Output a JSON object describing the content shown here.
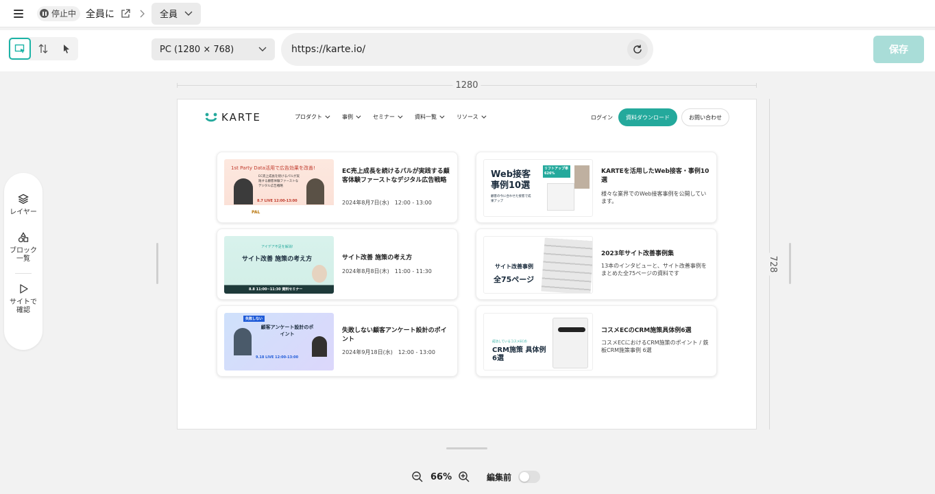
{
  "topbar": {
    "status": "停止中",
    "target_name": "全員に",
    "segment": "全員"
  },
  "toolbar": {
    "device": "PC (1280 × 768)",
    "url": "https://karte.io/",
    "save_label": "保存"
  },
  "left_panel": {
    "layers_label": "レイヤー",
    "blocks_label": "ブロック\n一覧",
    "preview_label": "サイトで\n確認"
  },
  "rulers": {
    "width_label": "1280",
    "height_label": "728"
  },
  "site": {
    "logo_text": "KARTE",
    "nav": [
      "プロダクト",
      "事例",
      "セミナー",
      "資料一覧",
      "リソース"
    ],
    "login": "ログイン",
    "download": "資料ダウンロード",
    "contact": "お問い合わせ",
    "cards": [
      {
        "title": "EC売上成長を続けるパルが実践する顧客体験ファーストなデジタル広告戦略",
        "sub": "2024年8月7日(水)　12:00 - 13:00",
        "thumb_text": "1st Party Data活用で広告効果を改善!",
        "thumb_sub": "EC売上成長を続けるパルが実践する顧客体験ファーストなデジタル広告戦略",
        "thumb_date": "8.7 LIVE 12:00-13:00",
        "thumb_brand": "PAL"
      },
      {
        "title": "KARTEを活用したWeb接客・事例10選",
        "sub": "様々な業界でのWeb接客事例を公開しています。",
        "thumb_text": "Web接客 事例10選",
        "thumb_sub": "顧客の今に合わせた接客で成果アップ",
        "thumb_badge": "リフトアップ率 626%"
      },
      {
        "title": "サイト改善 施策の考え方",
        "sub": "2024年8月8日(木)　11:00 - 11:30",
        "thumb_text": "サイト改善 施策の考え方",
        "thumb_sub": "アイデア不足を解消!",
        "thumb_date": "8.8 11:00~11:30 資料セミナー"
      },
      {
        "title": "2023年サイト改善事例集",
        "sub": "13本のインタビューと、サイト改善事例をまとめた全75ページの資料です",
        "thumb_text": "サイト改善事例",
        "thumb_sub": "全75ページ"
      },
      {
        "title": "失敗しない顧客アンケート設計のポイント",
        "sub": "2024年9月18日(水)　12:00 - 13:00",
        "thumb_text": "顧客アンケート設計のポイント",
        "thumb_sub": "失敗しない",
        "thumb_date": "9.18 LIVE 12:00-13:00"
      },
      {
        "title": "コスメECのCRM施策具体例6選",
        "sub": "コスメECにおけるCRM施策のポイント / 鉄板CRM施策事例 6選",
        "thumb_text": "CRM施策 具体例6選",
        "thumb_sub": "成功しているコスメECの"
      }
    ]
  },
  "zoom": {
    "value": "66%",
    "toggle_label": "編集前"
  },
  "colors": {
    "accent": "#24a99c",
    "save_disabled": "#a9ddd8"
  }
}
